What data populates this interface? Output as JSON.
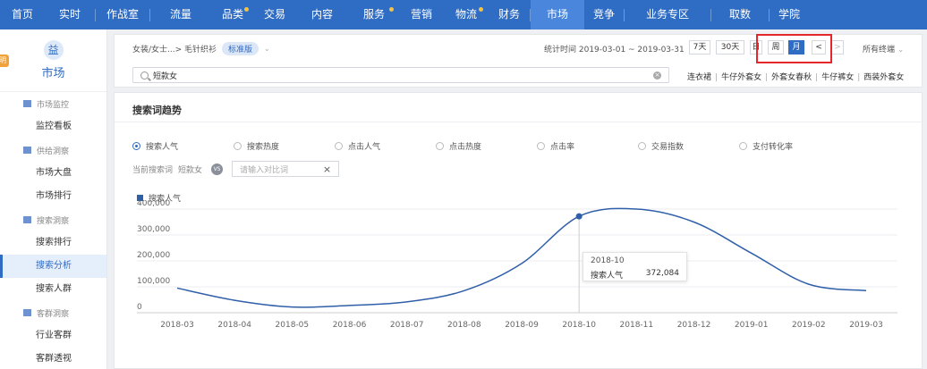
{
  "nav": {
    "items": [
      {
        "label": "首页",
        "w": 50
      },
      {
        "label": "实时",
        "w": 56
      },
      {
        "label": "作战室",
        "w": 60
      },
      {
        "label": "流量",
        "w": 68
      },
      {
        "label": "品类",
        "w": 48,
        "dot": true
      },
      {
        "label": "交易",
        "w": 46
      },
      {
        "label": "内容",
        "w": 60
      },
      {
        "label": "服务",
        "w": 56,
        "dot": true
      },
      {
        "label": "营销",
        "w": 50
      },
      {
        "label": "物流",
        "w": 50,
        "dot": true
      },
      {
        "label": "财务",
        "w": 46
      },
      {
        "label": "市场",
        "w": 60,
        "active": true
      },
      {
        "label": "竞争",
        "w": 44
      },
      {
        "label": "业务专区",
        "w": 96
      },
      {
        "label": "取数",
        "w": 64
      },
      {
        "label": "学院",
        "w": 44
      }
    ]
  },
  "sidebar": {
    "edge_tag": "明",
    "header": {
      "icon": "益",
      "label": "市场"
    },
    "groups": [
      {
        "label": "市场监控",
        "items": [
          "监控看板"
        ]
      },
      {
        "label": "供给洞察",
        "items": [
          "市场大盘",
          "市场排行"
        ]
      },
      {
        "label": "搜索洞察",
        "items": [
          "搜索排行",
          "搜索分析",
          "搜索人群"
        ]
      },
      {
        "label": "客群洞察",
        "items": [
          "行业客群",
          "客群透视"
        ]
      }
    ],
    "active_item": "搜索分析"
  },
  "filter": {
    "breadcrumb": "女装/女士...> 毛针织衫",
    "badge": "标准版",
    "stat_time": "统计时间 2019-03-01 ~ 2019-03-31",
    "period_buttons": [
      "7天",
      "30天",
      "日",
      "周",
      "月",
      "<",
      ">"
    ],
    "active_period": "月",
    "terminal": "所有终端",
    "search_value": "短款女",
    "related_terms": [
      "连衣裙",
      "牛仔外套女",
      "外套女春秋",
      "牛仔裤女",
      "西装外套女"
    ]
  },
  "panel": {
    "title": "搜索词趋势",
    "metrics": [
      "搜索人气",
      "搜索热度",
      "点击人气",
      "点击热度",
      "点击率",
      "交易指数",
      "支付转化率"
    ],
    "selected_metric": "搜索人气",
    "current_term_label": "当前搜索词",
    "current_term": "短款女",
    "vs_label": "VS",
    "compare_placeholder": "请输入对比词",
    "compare_clear": "×"
  },
  "tooltip": {
    "date": "2018-10",
    "label": "搜索人气",
    "value": "372,084"
  },
  "colors": {
    "primary": "#2f6cc4",
    "line": "#2f5fa8",
    "highlight": "#e5262a"
  },
  "chart_data": {
    "type": "line",
    "x": [
      "2018-03",
      "2018-04",
      "2018-05",
      "2018-06",
      "2018-07",
      "2018-08",
      "2018-09",
      "2018-10",
      "2018-11",
      "2018-12",
      "2019-01",
      "2019-02",
      "2019-03"
    ],
    "series": [
      {
        "name": "搜索人气",
        "values": [
          95000,
          48000,
          22000,
          28000,
          42000,
          85000,
          190000,
          372084,
          400000,
          350000,
          230000,
          110000,
          85000
        ]
      }
    ],
    "ylim": [
      0,
      400000
    ],
    "yticks": [
      "0",
      "100,000",
      "200,000",
      "300,000",
      "400,000"
    ],
    "highlight_index": 7,
    "grid": true,
    "legend": "top-left"
  }
}
